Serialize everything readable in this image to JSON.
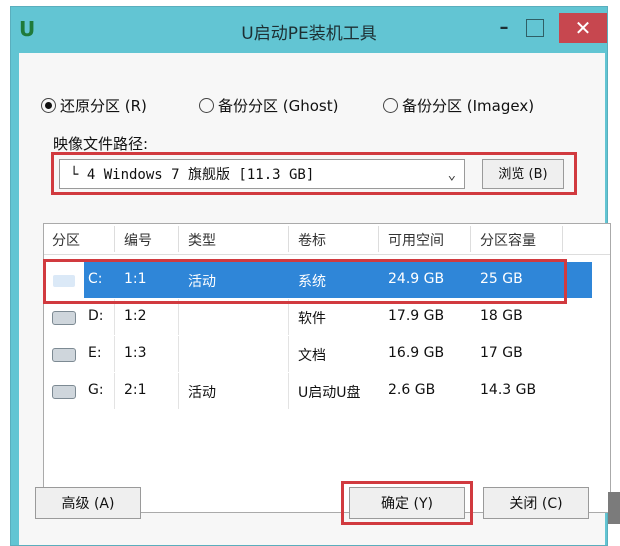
{
  "window": {
    "title": "U启动PE装机工具",
    "logo_text": "U",
    "close_glyph": "✕",
    "min_glyph": "–"
  },
  "mode_options": [
    {
      "label": "还原分区 (R)",
      "selected": true
    },
    {
      "label": "备份分区 (Ghost)",
      "selected": false
    },
    {
      "label": "备份分区 (Imagex)",
      "selected": false
    }
  ],
  "image_path": {
    "label": "映像文件路径:",
    "value": "└ 4 Windows 7 旗舰版 [11.3 GB]",
    "browse_label": "浏览 (B)"
  },
  "partition_table": {
    "headers": [
      "分区",
      "编号",
      "类型",
      "卷标",
      "可用空间",
      "分区容量"
    ],
    "rows": [
      {
        "drive": "C:",
        "number": "1:1",
        "type": "活动",
        "label": "系统",
        "free": "24.9 GB",
        "capacity": "25 GB",
        "selected": true,
        "icon": "hard-drive-icon"
      },
      {
        "drive": "D:",
        "number": "1:2",
        "type": "",
        "label": "软件",
        "free": "17.9 GB",
        "capacity": "18 GB",
        "selected": false,
        "icon": "hard-drive-icon"
      },
      {
        "drive": "E:",
        "number": "1:3",
        "type": "",
        "label": "文档",
        "free": "16.9 GB",
        "capacity": "17 GB",
        "selected": false,
        "icon": "hard-drive-icon"
      },
      {
        "drive": "G:",
        "number": "2:1",
        "type": "活动",
        "label": "U启动U盘",
        "free": "2.6 GB",
        "capacity": "14.3 GB",
        "selected": false,
        "icon": "usb-drive-icon"
      }
    ]
  },
  "buttons": {
    "advanced": "高级 (A)",
    "ok": "确定 (Y)",
    "close": "关闭 (C)"
  },
  "colors": {
    "title_bar": "#62c5d3",
    "selection": "#2f86d8",
    "highlight_box": "#d13a3f"
  }
}
